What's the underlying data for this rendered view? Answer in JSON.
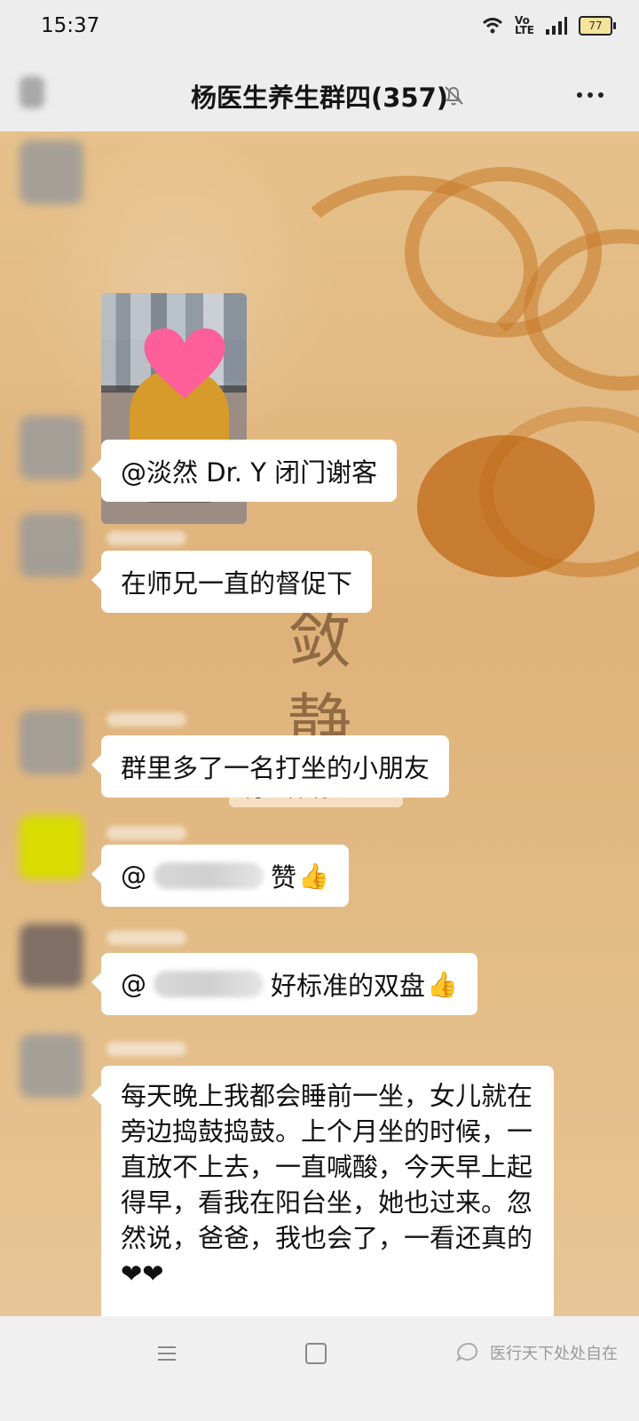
{
  "status": {
    "time": "15:37",
    "battery": "77"
  },
  "header": {
    "title": "杨医生养生群四(357)"
  },
  "chat": {
    "messages": [
      {
        "type": "image",
        "description": "child sitting"
      },
      {
        "text": "@淡然 Dr. Y 闭门谢客"
      },
      {
        "text": "在师兄一直的督促下"
      },
      {
        "text": "群里多了一名打坐的小朋友"
      },
      {
        "prefix": "@",
        "text": "赞",
        "emoji": "👍"
      },
      {
        "prefix": "@",
        "text": "好标准的双盘",
        "emoji": "👍"
      },
      {
        "text": "每天晚上我都会睡前一坐，女儿就在旁边捣鼓捣鼓。上个月坐的时候，一直放不上去，一直喊酸，今天早上起得早，看我在阳台坐，她也过来。忽然说，爸爸，我也会了，一看还真的❤❤"
      }
    ],
    "timestamp": "3月12日 晚上23:59",
    "background_text": "敛静"
  },
  "bottom": {
    "watermark": "医行天下处处自在"
  }
}
